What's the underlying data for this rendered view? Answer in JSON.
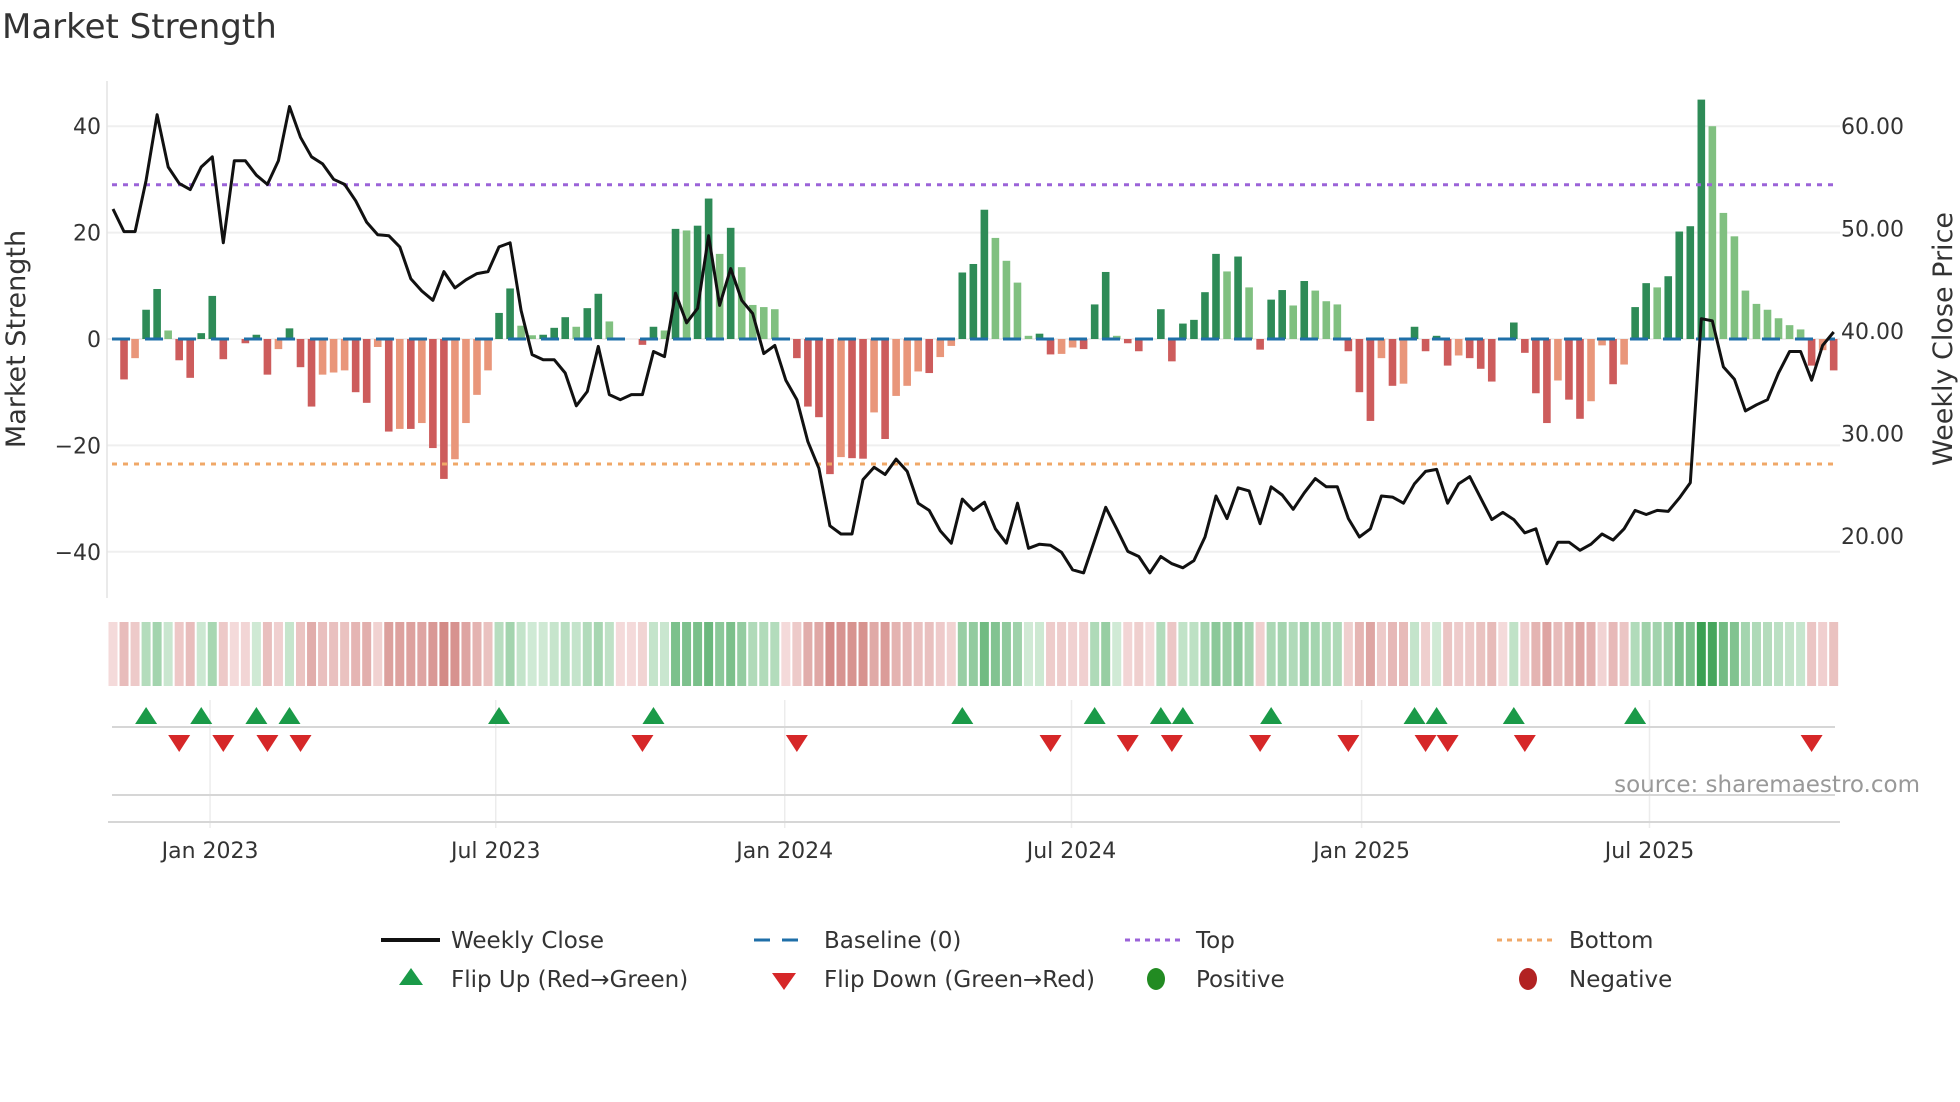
{
  "chart_data": {
    "type": "bar",
    "title": "Market Strength",
    "ylabel": "Market Strength",
    "y2label": "Weekly Close Price",
    "ylim": [
      -49,
      49
    ],
    "y2lim": [
      14.5,
      62.2
    ],
    "yticks": [
      "40",
      "20",
      "0",
      "−20",
      "−40"
    ],
    "ytick_values": [
      40,
      20,
      0,
      -20,
      -40
    ],
    "y2ticks": [
      "60.00",
      "50.00",
      "40.00",
      "30.00",
      "20.00"
    ],
    "y2tick_values": [
      60,
      50,
      40,
      30,
      20
    ],
    "xticks": [
      {
        "label": "Jan 2023",
        "week": 8.8
      },
      {
        "label": "Jul 2023",
        "week": 34.7
      },
      {
        "label": "Jan 2024",
        "week": 60.9
      },
      {
        "label": "Jul 2024",
        "week": 86.9
      },
      {
        "label": "Jan 2025",
        "week": 113.2
      },
      {
        "label": "Jul 2025",
        "week": 139.3
      }
    ],
    "top_level": 29,
    "bottom_level": -23.5,
    "baseline": 0,
    "grid": true,
    "legend_placement": "bottom",
    "source": "source: sharemaestro.com",
    "strength": [
      0,
      -7.6,
      -3.6,
      5.5,
      9.4,
      1.6,
      -4,
      -7.3,
      1.1,
      8.1,
      -3.8,
      0,
      -0.8,
      0.8,
      -6.7,
      -1.9,
      2,
      -5.3,
      -12.7,
      -6.7,
      -6.3,
      -5.9,
      -10,
      -12,
      -1.5,
      -17.4,
      -16.9,
      -16.9,
      -15.8,
      -20.5,
      -26.3,
      -22.6,
      -15.8,
      -10.5,
      -5.9,
      4.9,
      9.5,
      2.5,
      0.7,
      0.8,
      2.1,
      4.1,
      2.3,
      5.8,
      8.5,
      3.3,
      0,
      0,
      -1.1,
      2.3,
      1.6,
      20.7,
      20.4,
      21.3,
      26.4,
      16,
      20.9,
      13.5,
      6.4,
      6,
      5.6,
      0,
      -3.6,
      -12.7,
      -14.7,
      -25.4,
      -22.2,
      -22.4,
      -22.5,
      -13.8,
      -18.8,
      -10.7,
      -8.8,
      -6.1,
      -6.4,
      -3.4,
      -1.3,
      12.5,
      14.1,
      24.3,
      19,
      14.7,
      10.6,
      0.6,
      1,
      -2.9,
      -2.8,
      -1.6,
      -1.9,
      6.5,
      12.6,
      0.6,
      -0.8,
      -2.3,
      0,
      5.6,
      -4.2,
      2.9,
      3.6,
      8.8,
      16,
      12.7,
      15.5,
      9.7,
      -2,
      7.4,
      9.2,
      6.3,
      10.9,
      9.1,
      7.1,
      6.5,
      -2.3,
      -10,
      -15.4,
      -3.6,
      -8.8,
      -8.4,
      2.3,
      -2.3,
      0.6,
      -5,
      -3.1,
      -3.6,
      -5.6,
      -8,
      0,
      3.1,
      -2.6,
      -10.2,
      -15.8,
      -7.8,
      -11.4,
      -15,
      -11.7,
      -1.2,
      -8.5,
      -4.8,
      6,
      10.5,
      9.7,
      11.8,
      20.2,
      21.2,
      45,
      40,
      23.7,
      19.3,
      9.1,
      6.6,
      5.5,
      3.9,
      2.6,
      1.8,
      -5,
      -2.1,
      -5.9
    ],
    "weekly_close": [
      51.9,
      49.7,
      49.7,
      54.7,
      61.1,
      56,
      54.4,
      53.8,
      56,
      57,
      48.6,
      56.6,
      56.6,
      55.2,
      54.3,
      56.6,
      61.9,
      58.9,
      57,
      56.3,
      54.8,
      54.3,
      52.7,
      50.6,
      49.4,
      49.3,
      48.2,
      45.1,
      43.9,
      43,
      45.8,
      44.2,
      45,
      45.6,
      45.8,
      48.2,
      48.6,
      42,
      37.7,
      37.2,
      37.2,
      35.9,
      32.7,
      34.1,
      38.5,
      33.8,
      33.3,
      33.8,
      33.8,
      38,
      37.5,
      43.7,
      40.8,
      42.2,
      49.3,
      42.5,
      46.1,
      43,
      41.7,
      37.8,
      38.6,
      35.2,
      33.3,
      29.2,
      26.6,
      21,
      20.2,
      20.2,
      25.5,
      26.7,
      26,
      27.5,
      26.3,
      23.2,
      22.5,
      20.5,
      19.3,
      23.6,
      22.5,
      23.3,
      20.7,
      19.3,
      23.2,
      18.8,
      19.2,
      19.1,
      18.4,
      16.7,
      16.4,
      19.6,
      22.8,
      20.7,
      18.5,
      18,
      16.4,
      18,
      17.3,
      16.9,
      17.6,
      19.9,
      23.9,
      21.7,
      24.7,
      24.4,
      21.2,
      24.8,
      24,
      22.6,
      24.2,
      25.6,
      24.8,
      24.8,
      21.7,
      19.9,
      20.7,
      23.9,
      23.8,
      23.2,
      25.1,
      26.3,
      26.5,
      23.2,
      25.1,
      25.8,
      23.7,
      21.6,
      22.3,
      21.6,
      20.3,
      20.7,
      17.3,
      19.4,
      19.4,
      18.6,
      19.2,
      20.2,
      19.6,
      20.7,
      22.5,
      22.1,
      22.5,
      22.4,
      23.7,
      25.2,
      41.2,
      41,
      36.5,
      35.3,
      32.2,
      32.8,
      33.3,
      35.9,
      38,
      38,
      35.2,
      38.6,
      39.9
    ]
  },
  "legend": {
    "weekly_close": "Weekly Close",
    "baseline": "Baseline (0)",
    "top": "Top",
    "bottom": "Bottom",
    "flip_up": "Flip Up (Red→Green)",
    "flip_down": "Flip Down (Green→Red)",
    "positive": "Positive",
    "negative": "Negative"
  },
  "colors": {
    "pos_rising": "#2e8b57",
    "pos_falling": "#80c080",
    "neg_falling": "#cd5c5c",
    "neg_rising": "#e9967a",
    "line": "#111111",
    "baseline": "#1f6fa8",
    "top": "#9b63d8",
    "bottom": "#f0a868",
    "flip_up": "#1a9a48",
    "flip_down": "#d62728",
    "positive": "#228b22",
    "negative": "#b22222"
  }
}
